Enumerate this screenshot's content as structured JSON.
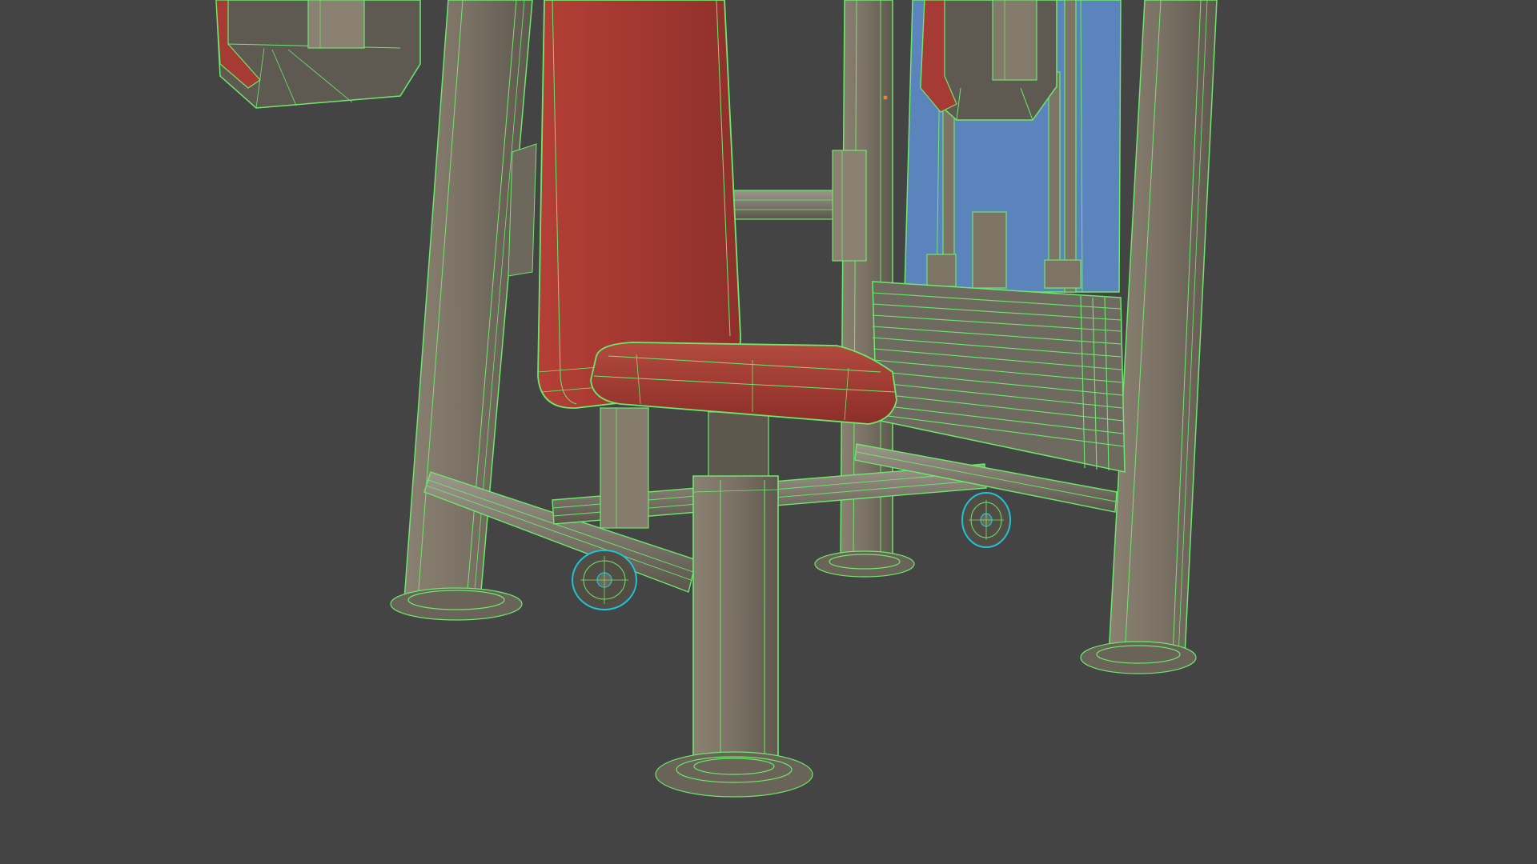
{
  "viewport": {
    "background": "#444444",
    "render_mode": "shaded-with-wireframe",
    "wire_color": "#6CE96B",
    "selected_wire_color": "#1FC4D8"
  },
  "model": {
    "name": "chest-press-machine",
    "parts": [
      "back-pad",
      "seat-cushion",
      "handle-pad-left",
      "handle-pad-right",
      "weight-stack",
      "guide-rods",
      "frame-uprights",
      "base-rails",
      "floor-caps",
      "transport-wheels"
    ],
    "materials": {
      "frame": "#7D7466",
      "upholstery": "#A63A34",
      "panel": "#5A82B8",
      "weights": "#6E6A60"
    }
  }
}
